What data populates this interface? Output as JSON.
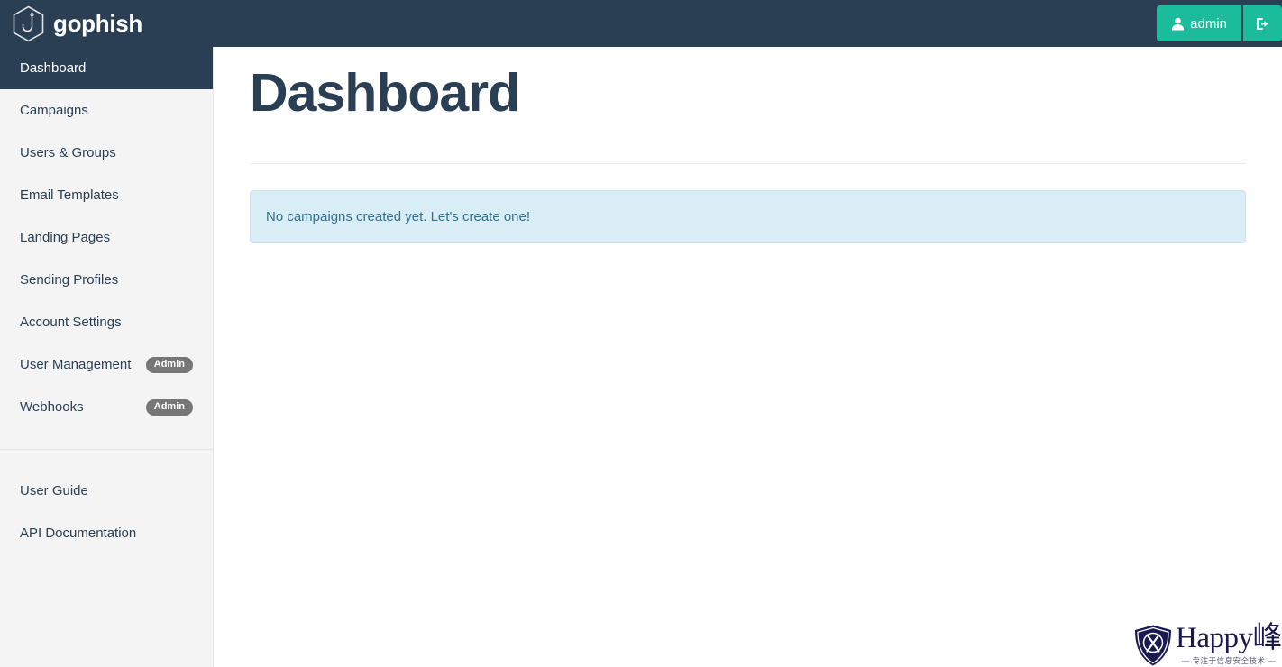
{
  "navbar": {
    "brand_text": "gophish",
    "brand_logo_name": "gophish-hook-logo",
    "user_button_label": "admin",
    "user_icon_name": "user-icon",
    "logout_icon_name": "sign-out-icon",
    "background_color": "#2a3f54",
    "button_color": "#1abc9c"
  },
  "sidebar": {
    "background_color": "#f4f4f4",
    "active_background_color": "#2a3f54",
    "items": [
      {
        "label": "Dashboard",
        "active": true,
        "badge": null
      },
      {
        "label": "Campaigns",
        "active": false,
        "badge": null
      },
      {
        "label": "Users & Groups",
        "active": false,
        "badge": null
      },
      {
        "label": "Email Templates",
        "active": false,
        "badge": null
      },
      {
        "label": "Landing Pages",
        "active": false,
        "badge": null
      },
      {
        "label": "Sending Profiles",
        "active": false,
        "badge": null
      },
      {
        "label": "Account Settings",
        "active": false,
        "badge": null
      },
      {
        "label": "User Management",
        "active": false,
        "badge": "Admin"
      },
      {
        "label": "Webhooks",
        "active": false,
        "badge": "Admin"
      }
    ],
    "footer_items": [
      {
        "label": "User Guide"
      },
      {
        "label": "API Documentation"
      }
    ],
    "badge_color": "#777777"
  },
  "main": {
    "page_title": "Dashboard",
    "alert_message": "No campaigns created yet. Let's create one!",
    "alert_background_color": "#d9edf7",
    "alert_text_color": "#31708f"
  },
  "watermark": {
    "title": "Happy峰",
    "subtitle": "— 专注于信息安全技术 —",
    "shield_icon_name": "shield-crossed-x-icon",
    "color": "#191950"
  }
}
